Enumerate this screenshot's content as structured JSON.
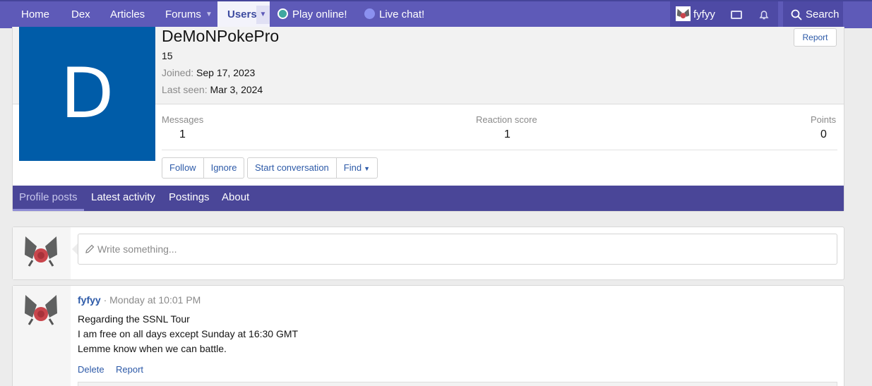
{
  "nav": {
    "home": "Home",
    "dex": "Dex",
    "articles": "Articles",
    "forums": "Forums",
    "users": "Users",
    "play_online": "Play online!",
    "live_chat": "Live chat!",
    "username": "fyfyy",
    "search": "Search"
  },
  "profile": {
    "name": "DeMoNPokePro",
    "avatar_letter": "D",
    "age": "15",
    "joined_label": "Joined:",
    "joined_value": "Sep 17, 2023",
    "last_seen_label": "Last seen:",
    "last_seen_value": "Mar 3, 2024",
    "report": "Report",
    "stats": {
      "messages_label": "Messages",
      "messages_value": "1",
      "reaction_label": "Reaction score",
      "reaction_value": "1",
      "points_label": "Points",
      "points_value": "0"
    },
    "buttons": {
      "follow": "Follow",
      "ignore": "Ignore",
      "start_conversation": "Start conversation",
      "find": "Find"
    },
    "tabs": [
      "Profile posts",
      "Latest activity",
      "Postings",
      "About"
    ]
  },
  "write": {
    "placeholder": "Write something..."
  },
  "post": {
    "author": "fyfyy",
    "time": "· Monday at 10:01 PM",
    "lines": [
      "Regarding the SSNL Tour",
      "I am free on all days except Sunday at 16:30 GMT",
      "Lemme know when we can battle."
    ],
    "delete": "Delete",
    "report": "Report"
  },
  "colors": {
    "nav_bg": "#5e5ab8",
    "tab_bg": "#4a4698",
    "avatar_bg": "#005ca8",
    "link": "#2d5aa8"
  },
  "icons": [
    "play-online-icon",
    "discord-icon",
    "envelope-icon",
    "bell-icon",
    "search-icon",
    "pencil-icon",
    "chevron-down-icon"
  ]
}
